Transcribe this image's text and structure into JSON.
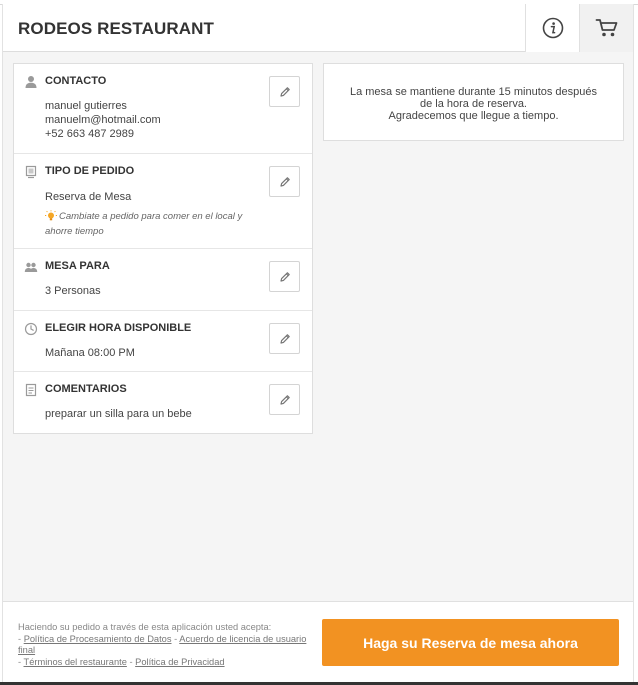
{
  "header": {
    "title": "RODEOS RESTAURANT"
  },
  "sections": {
    "contact": {
      "title": "CONTACTO",
      "name": "manuel gutierres",
      "email": "manuelm@hotmail.com",
      "phone": "+52 663 487 2989"
    },
    "order_type": {
      "title": "TIPO DE PEDIDO",
      "value": "Reserva de Mesa",
      "tip": "Cambiate a pedido para comer en el local y ahorre tiempo"
    },
    "table": {
      "title": "MESA PARA",
      "value": "3 Personas"
    },
    "time": {
      "title": "ELEGIR HORA DISPONIBLE",
      "value": "Mañana 08:00 PM"
    },
    "comments": {
      "title": "COMENTARIOS",
      "value": "preparar un silla para un bebe"
    }
  },
  "notice": {
    "line1": "La mesa se mantiene durante 15 minutos después",
    "line2": "de la hora de reserva.",
    "line3": "Agradecemos que llegue a tiempo."
  },
  "footer": {
    "intro": "Haciendo su pedido a través de esta aplicación usted acepta:",
    "dash": "- ",
    "sep": " - ",
    "link_privacy_data": "Política de Procesamiento de Datos",
    "link_license": "Acuerdo de licencia de usuario final",
    "link_terms": "Términos del restaurante",
    "link_privacy": "Política de Privacidad",
    "cta_label": "Haga su Reserva de mesa ahora"
  },
  "colors": {
    "accent": "#f29222",
    "tip_bulb": "#f5a623"
  }
}
